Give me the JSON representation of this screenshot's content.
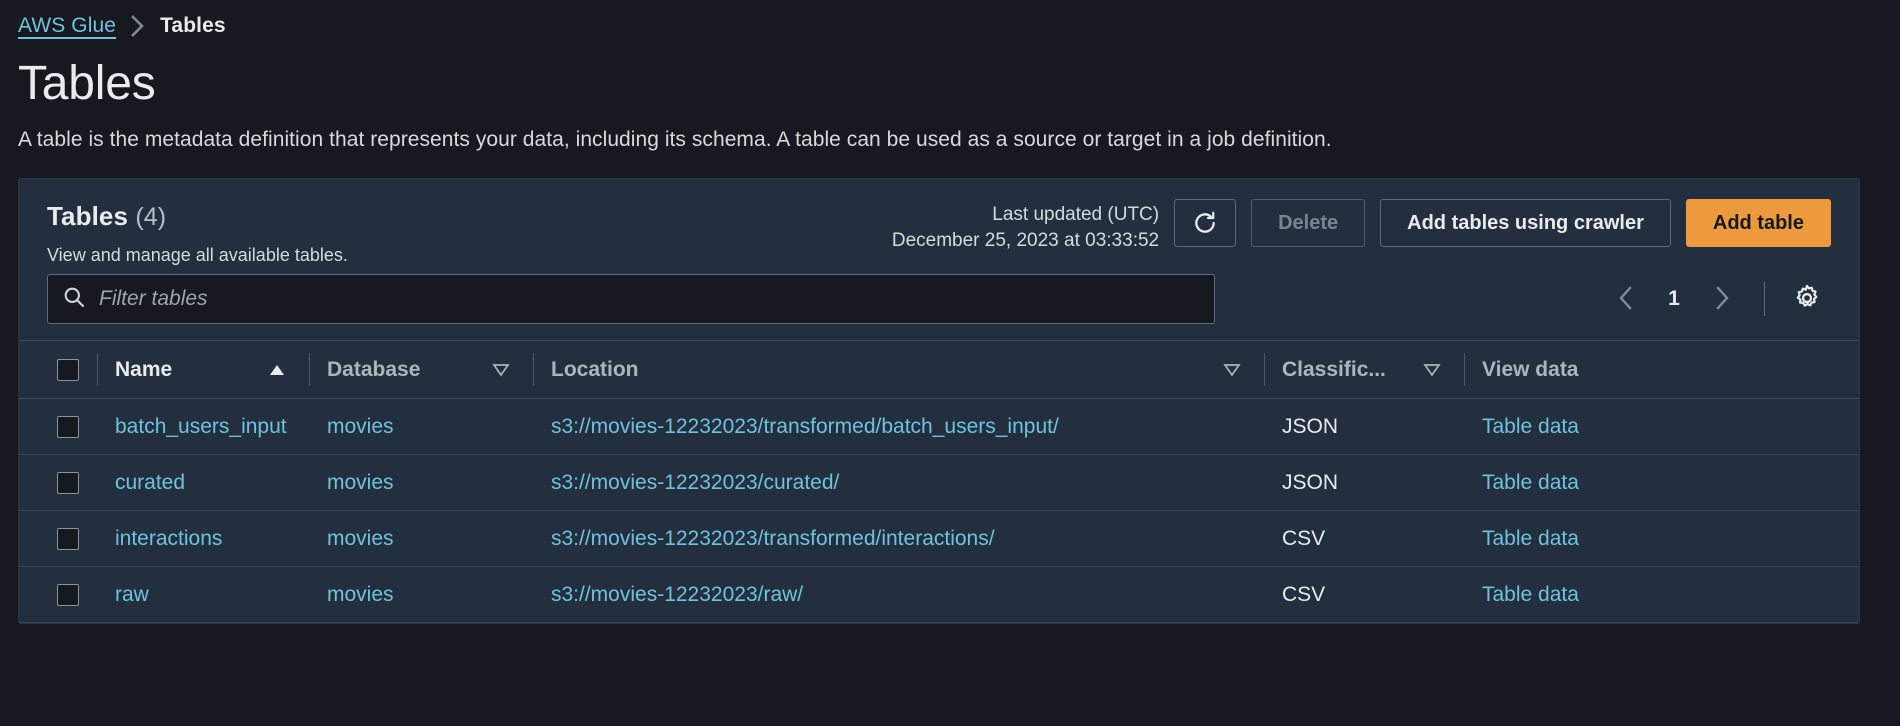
{
  "breadcrumb": {
    "root_label": "AWS Glue",
    "separator_icon": "chevron-right-icon",
    "current_label": "Tables"
  },
  "page": {
    "title": "Tables",
    "description": "A table is the metadata definition that represents your data, including its schema. A table can be used as a source or target in a job definition."
  },
  "card": {
    "title": "Tables",
    "count": "(4)",
    "subtitle": "View and manage all available tables.",
    "last_updated_label": "Last updated (UTC)",
    "last_updated_value": "December 25, 2023 at 03:33:52",
    "refresh_icon": "refresh-icon",
    "delete_label": "Delete",
    "add_crawler_label": "Add tables using crawler",
    "add_table_label": "Add table"
  },
  "filter": {
    "search_icon": "search-icon",
    "placeholder": "Filter tables",
    "value": ""
  },
  "pagination": {
    "prev_icon": "chevron-left-icon",
    "page": "1",
    "next_icon": "chevron-right-icon",
    "settings_icon": "gear-icon"
  },
  "table": {
    "columns": [
      {
        "label": "",
        "icon": "select-all-checkbox",
        "sorted": false
      },
      {
        "label": "Name",
        "icon": "sort-ascending-icon",
        "sorted": true
      },
      {
        "label": "Database",
        "icon": "sort-icon",
        "sorted": false
      },
      {
        "label": "Location",
        "icon": "sort-icon",
        "sorted": false
      },
      {
        "label": "Classific...",
        "icon": "sort-icon",
        "sorted": false
      },
      {
        "label": "View data",
        "icon": "",
        "sorted": false
      }
    ],
    "rows": [
      {
        "name": "batch_users_input",
        "database": "movies",
        "location": "s3://movies-12232023/transformed/batch_users_input/",
        "classification": "JSON",
        "view_data": "Table data"
      },
      {
        "name": "curated",
        "database": "movies",
        "location": "s3://movies-12232023/curated/",
        "classification": "JSON",
        "view_data": "Table data"
      },
      {
        "name": "interactions",
        "database": "movies",
        "location": "s3://movies-12232023/transformed/interactions/",
        "classification": "CSV",
        "view_data": "Table data"
      },
      {
        "name": "raw",
        "database": "movies",
        "location": "s3://movies-12232023/raw/",
        "classification": "CSV",
        "view_data": "Table data"
      }
    ]
  },
  "colors": {
    "background": "#16191f",
    "card": "#232f3e",
    "link": "#6fc2de",
    "primary_button": "#ec9a3d",
    "text": "#e9ebed",
    "muted": "#aab7b8"
  }
}
